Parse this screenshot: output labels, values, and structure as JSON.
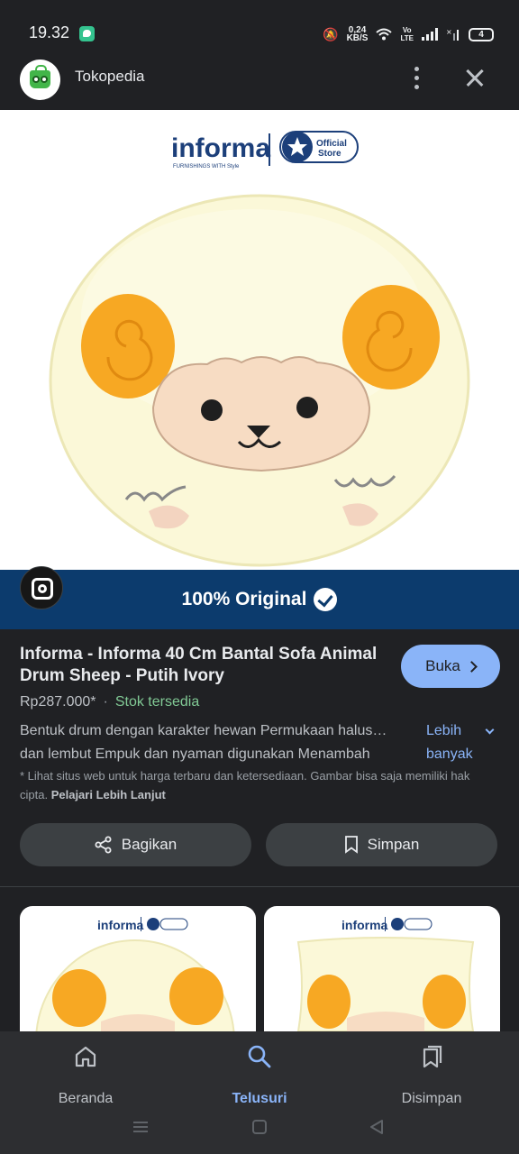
{
  "status_bar": {
    "time": "19.32",
    "net_speed_top": "0,24",
    "net_speed_bottom": "KB/S",
    "lte": "Vo\nLTE",
    "battery": "4"
  },
  "app_header": {
    "title": "Tokopedia"
  },
  "product_image": {
    "brand": "informa",
    "brand_tagline": "FURNISHINGS WITH Style",
    "badge_top": "Official",
    "badge_bottom": "Store"
  },
  "banner": {
    "text": "100% Original"
  },
  "product": {
    "title": "Informa - Informa 40 Cm Bantal Sofa Animal Drum Sheep - Putih Ivory",
    "price": "Rp287.000*",
    "separator": "·",
    "stock": "Stok tersedia",
    "description": "Bentuk drum dengan karakter hewan Permukaan halus… dan lembut Empuk dan nyaman digunakan Menambah",
    "more_label": "Lebih banyak",
    "disclaimer": "* Lihat situs web untuk harga terbaru dan ketersediaan. Gambar bisa saja memiliki hak cipta.",
    "disclaimer_link": "Pelajari Lebih Lanjut",
    "open_label": "Buka",
    "share_label": "Bagikan",
    "save_label": "Simpan"
  },
  "bottom_nav": {
    "items": [
      {
        "label": "Beranda",
        "icon": "home-icon"
      },
      {
        "label": "Telusuri",
        "icon": "search-icon"
      },
      {
        "label": "Disimpan",
        "icon": "collections-icon"
      }
    ],
    "active": "Telusuri"
  },
  "colors": {
    "background": "#202124",
    "accent": "#8ab4f8",
    "stock": "#81c995",
    "banner": "#0c3b6d"
  }
}
